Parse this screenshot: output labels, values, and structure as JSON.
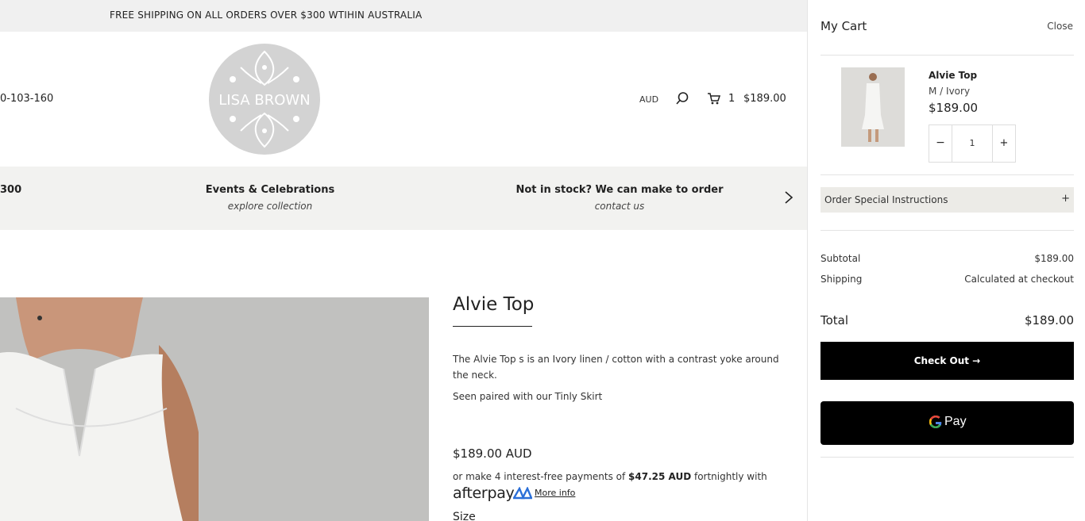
{
  "announcement": {
    "text": "FREE SHIPPING ON ALL ORDERS OVER $300 WTIHIN AUSTRALIA"
  },
  "header": {
    "phone_fragment": "0-103-160",
    "logo_text": "LISA BROWN",
    "currency": "AUD",
    "cart_count": "1",
    "cart_total": "$189.00"
  },
  "promo_bar": {
    "fragment": "300",
    "items": [
      {
        "title": "Events & Celebrations",
        "subtitle": "explore collection"
      },
      {
        "title": "Not in stock? We can make to order",
        "subtitle": "contact us"
      }
    ]
  },
  "product": {
    "title": "Alvie Top",
    "description": "The Alvie Top s is an Ivory linen / cotton with a contrast yoke around the neck.",
    "paired_with": "Seen paired with our Tinly Skirt",
    "price": "$189.00 AUD",
    "afterpay": {
      "prefix": "or make 4 interest-free payments of ",
      "amount": "$47.25 AUD",
      "suffix": " fortnightly with",
      "logo": "afterpay",
      "more_info": "More info"
    },
    "size_label": "Size"
  },
  "cart_drawer": {
    "title": "My Cart",
    "close_label": "Close",
    "item": {
      "name": "Alvie Top",
      "variant": "M / Ivory",
      "price": "$189.00",
      "quantity": "1",
      "minus_label": "−",
      "plus_label": "+"
    },
    "instructions_label": "Order Special Instructions",
    "instructions_toggle": "+",
    "subtotal_label": "Subtotal",
    "subtotal_value": "$189.00",
    "shipping_label": "Shipping",
    "shipping_value": "Calculated at checkout",
    "total_label": "Total",
    "total_value": "$189.00",
    "checkout_label": "Check Out →",
    "gpay_label": "Pay"
  },
  "icons": {
    "search": "search-icon",
    "cart": "cart-icon",
    "next": "chevron-right-icon",
    "gpay": "google-g-icon"
  },
  "colors": {
    "announce_bg": "#f0f0f0",
    "promo_bg": "#f2f2f0",
    "button_bg": "#000000",
    "instructions_bg": "#ecebe7"
  }
}
